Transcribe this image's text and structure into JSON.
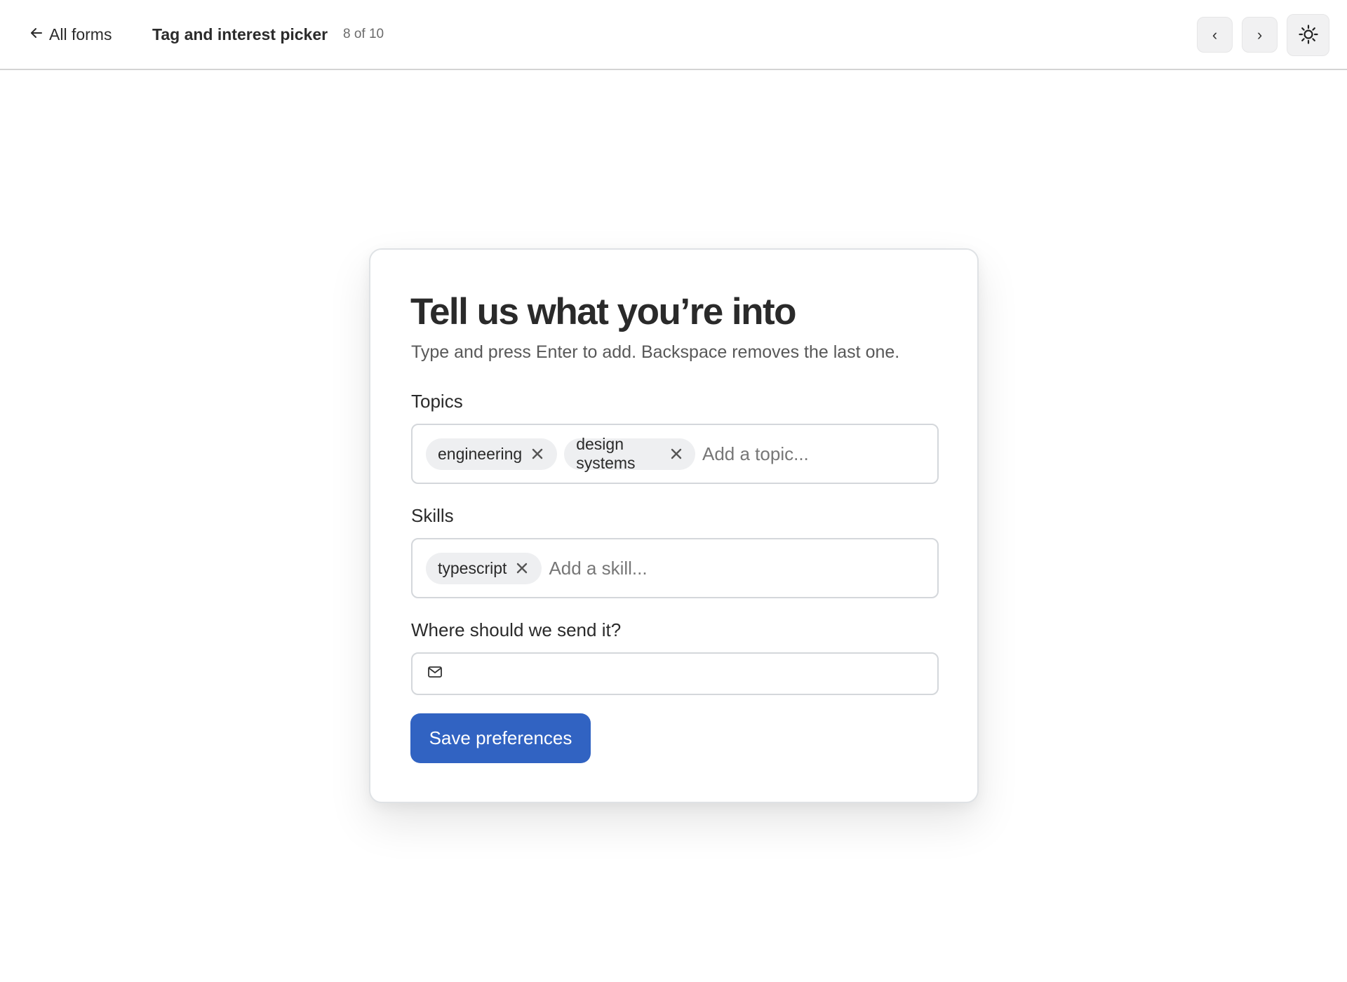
{
  "header": {
    "back_label": "All forms",
    "title": "Tag and interest picker",
    "counter": "8 of 10",
    "prev_label": "‹",
    "next_label": "›",
    "theme_icon": "sun-icon"
  },
  "card": {
    "title": "Tell us what you’re into",
    "subtitle": "Type and press Enter to add. Backspace removes the last one.",
    "topics": {
      "label": "Topics",
      "tags": [
        "engineering",
        "design systems"
      ],
      "placeholder": "Add a topic...",
      "value": ""
    },
    "skills": {
      "label": "Skills",
      "tags": [
        "typescript"
      ],
      "placeholder": "Add a skill...",
      "value": ""
    },
    "email": {
      "label": "Where should we send it?",
      "icon": "mail-icon",
      "value": "",
      "placeholder": ""
    },
    "submit_label": "Save preferences"
  },
  "colors": {
    "accent": "#3163c2",
    "tag_bg": "#eeeff1",
    "border": "#d4d7db"
  }
}
